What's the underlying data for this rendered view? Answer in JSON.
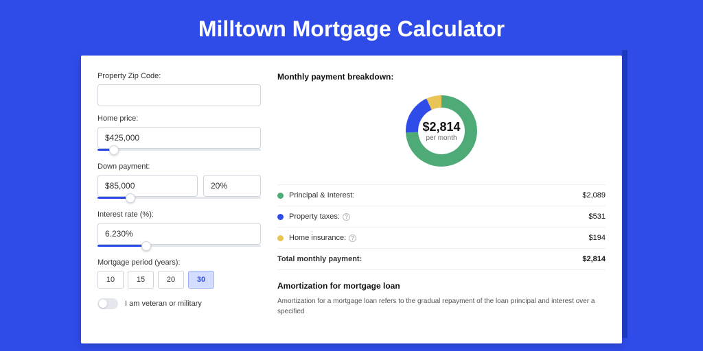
{
  "title": "Milltown Mortgage Calculator",
  "form": {
    "zip_label": "Property Zip Code:",
    "zip_value": "",
    "home_price_label": "Home price:",
    "home_price_value": "$425,000",
    "home_price_slider_pct": 10,
    "down_payment_label": "Down payment:",
    "down_payment_value": "$85,000",
    "down_payment_pct_value": "20%",
    "down_payment_slider_pct": 20,
    "interest_label": "Interest rate (%):",
    "interest_value": "6.230%",
    "interest_slider_pct": 30,
    "period_label": "Mortgage period (years):",
    "periods": [
      "10",
      "15",
      "20",
      "30"
    ],
    "period_active": "30",
    "veteran_label": "I am veteran or military"
  },
  "breakdown": {
    "heading": "Monthly payment breakdown:",
    "center_amount": "$2,814",
    "center_sub": "per month",
    "rows": [
      {
        "color": "green",
        "label": "Principal & Interest:",
        "value": "$2,089",
        "help": false
      },
      {
        "color": "blue",
        "label": "Property taxes:",
        "value": "$531",
        "help": true
      },
      {
        "color": "yellow",
        "label": "Home insurance:",
        "value": "$194",
        "help": true
      }
    ],
    "total_label": "Total monthly payment:",
    "total_value": "$2,814"
  },
  "chart_data": {
    "type": "pie",
    "title": "Monthly payment breakdown",
    "series": [
      {
        "name": "Principal & Interest",
        "value": 2089,
        "color": "#4eab77"
      },
      {
        "name": "Property taxes",
        "value": 531,
        "color": "#2f4ce8"
      },
      {
        "name": "Home insurance",
        "value": 194,
        "color": "#e9c558"
      }
    ],
    "total": 2814,
    "unit": "USD per month"
  },
  "amortization": {
    "heading": "Amortization for mortgage loan",
    "body": "Amortization for a mortgage loan refers to the gradual repayment of the loan principal and interest over a specified"
  }
}
